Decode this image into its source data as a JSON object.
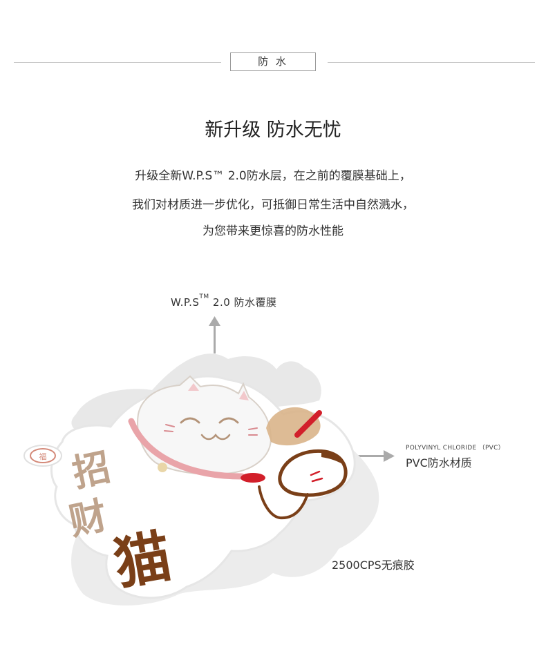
{
  "section": {
    "tag": "防 水"
  },
  "headline": "新升级 防水无忧",
  "paragraph": {
    "line1": "升级全新W.P.S™ 2.0防水层，在之前的覆膜基础上，",
    "line2": "我们对材质进一步优化，可抵御日常生活中自然溅水，",
    "line3": "为您带来更惊喜的防水性能"
  },
  "callouts": {
    "film_brand": "W.P.S",
    "film_tm": "TM",
    "film_rest": " 2.0 防水覆膜",
    "pvc_en": "POLYVINYL CHLORIDE （PVC）",
    "pvc_cn": "PVC防水材质",
    "glue": "2500CPS无痕胶"
  },
  "sticker": {
    "text": "招财猫",
    "badge": "福"
  },
  "icons": [
    "arrow-up-icon",
    "arrow-right-icon",
    "arrow-right-icon"
  ],
  "colors": {
    "rule": "#c9c9c9",
    "text": "#333333",
    "arrow": "#aaaaaa",
    "cat_brown": "#7a3f18",
    "collar_red": "#d21f2a",
    "tan": "#b49479"
  }
}
